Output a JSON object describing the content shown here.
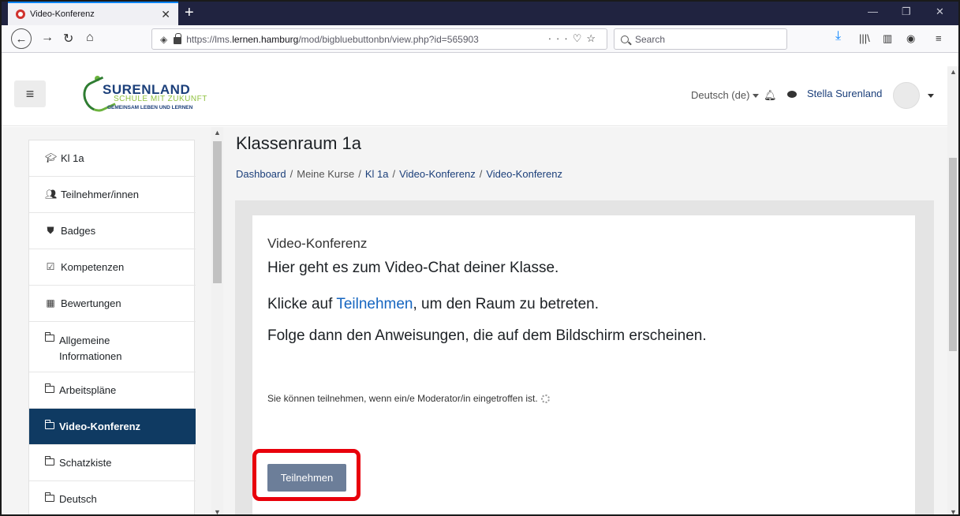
{
  "browser": {
    "tab_title": "Video-Konferenz",
    "url_prefix": "https://lms.",
    "url_domain": "lernen.hamburg",
    "url_path": "/mod/bigbluebuttonbn/view.php?id=565903",
    "search_placeholder": "Search"
  },
  "header": {
    "logo_main": "SURENLAND",
    "logo_sub": "SCHULE MIT ZUKUNFT",
    "logo_tag": "GEMEINSAM LEBEN UND LERNEN",
    "language": "Deutsch (de)",
    "user_name": "Stella Surenland"
  },
  "sidebar": {
    "items": [
      {
        "label": "Kl 1a",
        "icon": "graduation-cap-icon"
      },
      {
        "label": "Teilnehmer/innen",
        "icon": "users-icon"
      },
      {
        "label": "Badges",
        "icon": "shield-icon"
      },
      {
        "label": "Kompetenzen",
        "icon": "checkbox-icon"
      },
      {
        "label": "Bewertungen",
        "icon": "table-icon"
      },
      {
        "label": "Allgemeine Informationen",
        "icon": "folder-icon"
      },
      {
        "label": "Arbeitspläne",
        "icon": "folder-icon"
      },
      {
        "label": "Video-Konferenz",
        "icon": "folder-icon",
        "active": true
      },
      {
        "label": "Schatzkiste",
        "icon": "folder-icon"
      },
      {
        "label": "Deutsch",
        "icon": "folder-icon"
      }
    ]
  },
  "main": {
    "page_title": "Klassenraum 1a",
    "breadcrumb": [
      "Dashboard",
      "Meine Kurse",
      "Kl 1a",
      "Video-Konferenz",
      "Video-Konferenz"
    ],
    "breadcrumb_sep": "/",
    "card_title": "Video-Konferenz",
    "line1": "Hier geht es zum Video-Chat deiner Klasse.",
    "line2_before": "Klicke auf ",
    "line2_link": "Teilnehmen",
    "line2_after": ", um den Raum zu betreten.",
    "line3": "Folge dann den Anweisungen, die auf dem Bildschirm erscheinen.",
    "status_note": "Sie können teilnehmen, wenn ein/e Moderator/in eingetroffen ist.",
    "join_button": "Teilnehmen"
  },
  "colors": {
    "active_nav": "#0f3a62",
    "link": "#1565c0",
    "button": "#6c7e99",
    "highlight": "#e8000b"
  }
}
